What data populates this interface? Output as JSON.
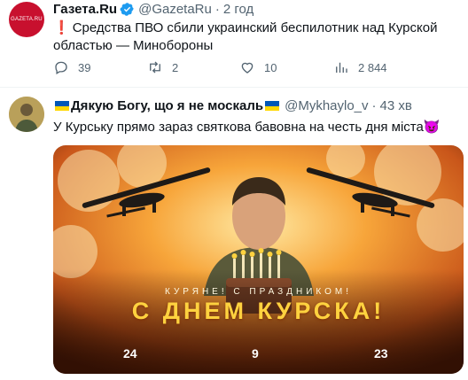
{
  "tweet1": {
    "avatar_text": "GAZETA.RU",
    "name": "Газета.Ru",
    "handle": "@GazetaRu",
    "separator": "·",
    "time": "2 год",
    "text": "Средства ПВО сбили украинский беспилотник над Курской областью — Минобороны",
    "emoji": "❗",
    "actions": {
      "reply": "39",
      "retweet": "2",
      "like": "10",
      "views": "2 844"
    }
  },
  "tweet2": {
    "name": "Дякую Богу, що я не москаль",
    "handle": "@Mykhaylo_v",
    "separator": "·",
    "time": "43 хв",
    "text": "У Курську прямо зараз святкова бавовна на честь дня міста",
    "emoji": "😈",
    "poster": {
      "subtitle": "КУРЯНЕ! С ПРАЗДНИКОМ!",
      "title": "С ДНЕМ КУРСКА!",
      "day": "24",
      "month": "9",
      "year": "23"
    }
  },
  "colors": {
    "verified": "#1d9bf0",
    "muted": "#536471",
    "flag_blue": "#0057b7",
    "flag_yellow": "#ffd700",
    "avatar_red": "#c8102e"
  },
  "icons": [
    "verified-badge-icon",
    "reply-icon",
    "retweet-icon",
    "like-icon",
    "views-icon",
    "ukraine-flag-icon",
    "drone-icon"
  ]
}
